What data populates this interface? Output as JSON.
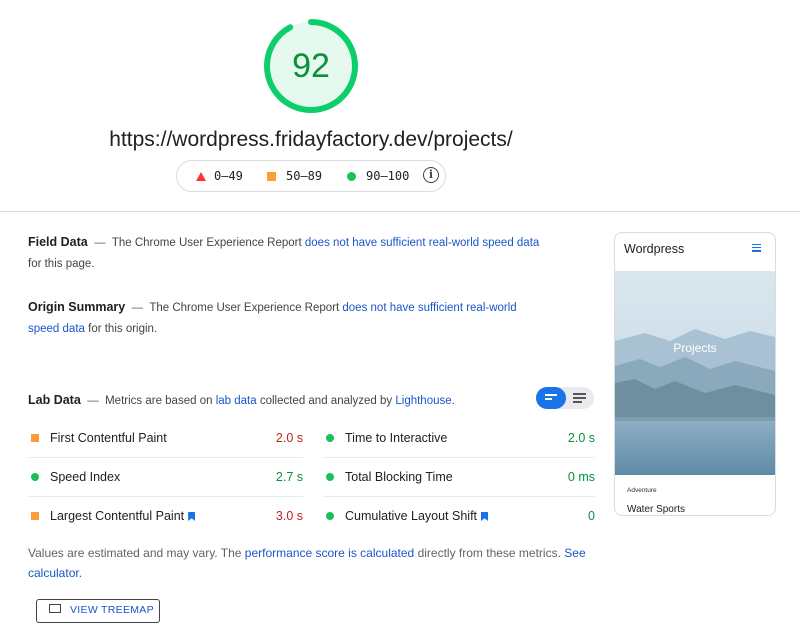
{
  "score": {
    "value": "92",
    "fraction": 0.92,
    "color": "#0cce6b"
  },
  "url": "https://wordpress.fridayfactory.dev/projects/",
  "legend": {
    "items": [
      {
        "range": "0–49",
        "color": "#ff3333",
        "shape": "triangle"
      },
      {
        "range": "50–89",
        "color": "#ffa400",
        "shape": "square"
      },
      {
        "range": "90–100",
        "color": "#0cce6b",
        "shape": "circle"
      }
    ],
    "info_icon": "info-icon"
  },
  "field_data": {
    "title": "Field Data",
    "text_before": "The Chrome User Experience Report",
    "link": "does not have sufficient real-world speed data",
    "text_after": "for this page."
  },
  "origin_summary": {
    "title": "Origin Summary",
    "text_before": "The Chrome User Experience Report",
    "link": "does not have sufficient real-world speed data",
    "text_after": "for this origin."
  },
  "lab_data": {
    "title": "Lab Data",
    "text_before": "Metrics are based on",
    "link1": "lab data",
    "text_mid": "collected and analyzed by",
    "link2": "Lighthouse",
    "text_after": ".",
    "toggle_icons": [
      "list-view-icon",
      "detailed-view-icon"
    ]
  },
  "metrics": {
    "left": [
      {
        "name": "First Contentful Paint",
        "value": "2.0 s",
        "status": "average",
        "bookmark": false
      },
      {
        "name": "Speed Index",
        "value": "2.7 s",
        "status": "good",
        "bookmark": false
      },
      {
        "name": "Largest Contentful Paint",
        "value": "3.0 s",
        "status": "average",
        "bookmark": true
      }
    ],
    "right": [
      {
        "name": "Time to Interactive",
        "value": "2.0 s",
        "status": "good",
        "bookmark": false
      },
      {
        "name": "Total Blocking Time",
        "value": "0 ms",
        "status": "good",
        "bookmark": false
      },
      {
        "name": "Cumulative Layout Shift",
        "value": "0",
        "status": "good",
        "bookmark": true
      }
    ]
  },
  "footnote": {
    "text_before": "Values are estimated and may vary. The",
    "link1": "performance score is calculated",
    "text_mid": "directly from these metrics.",
    "link2": "See calculator."
  },
  "treemap_button": {
    "label": "VIEW TREEMAP",
    "icon": "treemap-icon"
  },
  "preview": {
    "site_title": "Wordpress",
    "hero_text": "Projects",
    "category": "Adventure",
    "post_title": "Water Sports"
  }
}
